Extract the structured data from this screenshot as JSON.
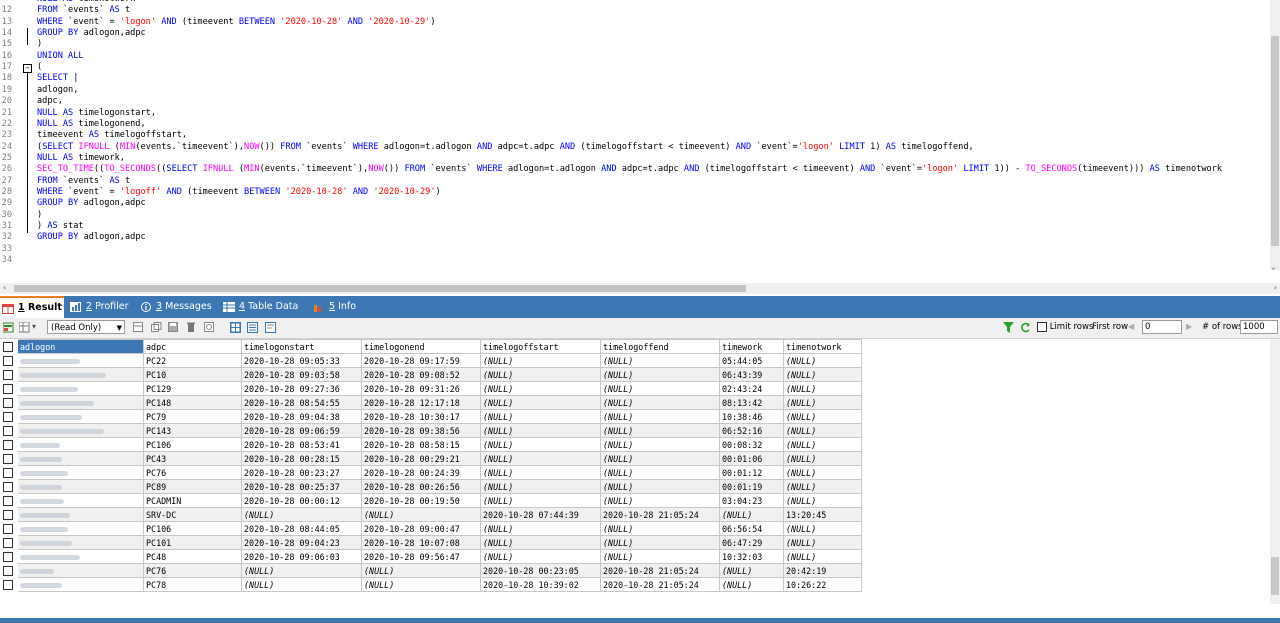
{
  "editor": {
    "lines": [
      {
        "n": "",
        "html": "<span class=\"kw\">NULL AS</span> timenotwork"
      },
      {
        "n": "12",
        "html": "<span class=\"kw\">FROM</span> `events` <span class=\"kw\">AS</span> t"
      },
      {
        "n": "13",
        "html": "<span class=\"kw\">WHERE</span> `event` = <span class=\"str\">'logon'</span> <span class=\"kw\">AND</span> (timeevent <span class=\"kw\">BETWEEN</span> <span class=\"str\">'2020-10-28'</span> <span class=\"kw\">AND</span> <span class=\"str\">'2020-10-29'</span>)"
      },
      {
        "n": "14",
        "html": "<span class=\"kw\">GROUP BY</span> adlogon,adpc"
      },
      {
        "n": "15",
        "html": ")"
      },
      {
        "n": "16",
        "html": "<span class=\"kw\">UNION ALL</span>"
      },
      {
        "n": "17",
        "html": "("
      },
      {
        "n": "18",
        "html": "<span class=\"kw\">SELECT</span> |"
      },
      {
        "n": "19",
        "html": "adlogon,"
      },
      {
        "n": "20",
        "html": "adpc,"
      },
      {
        "n": "21",
        "html": "<span class=\"kw\">NULL AS</span> timelogonstart,"
      },
      {
        "n": "22",
        "html": "<span class=\"kw\">NULL AS</span> timelogonend,"
      },
      {
        "n": "23",
        "html": "timeevent <span class=\"kw\">AS</span> timelogoffstart,"
      },
      {
        "n": "24",
        "html": "(<span class=\"kw\">SELECT</span> <span class=\"fn\">IFNULL</span> (<span class=\"fn\">MIN</span>(events.`timeevent`),<span class=\"fn\">NOW</span>()) <span class=\"kw\">FROM</span> `events` <span class=\"kw\">WHERE</span> adlogon=t.adlogon <span class=\"kw\">AND</span> adpc=t.adpc <span class=\"kw\">AND</span> (timelogoffstart &lt; timeevent) <span class=\"kw\">AND</span> `event`=<span class=\"str\">'logon'</span> <span class=\"kw\">LIMIT</span> 1) <span class=\"kw\">AS</span> timelogoffend,"
      },
      {
        "n": "25",
        "html": "<span class=\"kw\">NULL AS</span> timework,"
      },
      {
        "n": "26",
        "html": "<span class=\"fn\">SEC_TO_TIME</span>((<span class=\"fn\">TO_SECONDS</span>((<span class=\"kw\">SELECT</span> <span class=\"fn\">IFNULL</span> (<span class=\"fn\">MIN</span>(events.`timeevent`),<span class=\"fn\">NOW</span>()) <span class=\"kw\">FROM</span> `events` <span class=\"kw\">WHERE</span> adlogon=t.adlogon <span class=\"kw\">AND</span> adpc=t.adpc <span class=\"kw\">AND</span> (timelogoffstart &lt; timeevent) <span class=\"kw\">AND</span> `event`=<span class=\"str\">'logon'</span> <span class=\"kw\">LIMIT</span> 1)) - <span class=\"fn\">TO_SECONDS</span>(timeevent))) <span class=\"kw\">AS</span> timenotwork"
      },
      {
        "n": "27",
        "html": "<span class=\"kw\">FROM</span> `events` <span class=\"kw\">AS</span> t"
      },
      {
        "n": "28",
        "html": "<span class=\"kw\">WHERE</span> `event` = <span class=\"str\">'logoff'</span> <span class=\"kw\">AND</span> (timeevent <span class=\"kw\">BETWEEN</span> <span class=\"str\">'2020-10-28'</span> <span class=\"kw\">AND</span> <span class=\"str\">'2020-10-29'</span>)"
      },
      {
        "n": "29",
        "html": "<span class=\"kw\">GROUP BY</span> adlogon,adpc"
      },
      {
        "n": "30",
        "html": ")"
      },
      {
        "n": "31",
        "html": ") <span class=\"kw\">AS</span> stat"
      },
      {
        "n": "32",
        "html": "<span class=\"kw\">GROUP BY</span> adlogon,adpc"
      },
      {
        "n": "33",
        "html": ""
      },
      {
        "n": "34",
        "html": ""
      }
    ]
  },
  "tabs": [
    {
      "num": "1",
      "label": "Result",
      "active": true
    },
    {
      "num": "2",
      "label": "Profiler",
      "active": false
    },
    {
      "num": "3",
      "label": "Messages",
      "active": false
    },
    {
      "num": "4",
      "label": "Table Data",
      "active": false
    },
    {
      "num": "5",
      "label": "Info",
      "active": false
    }
  ],
  "toolbar": {
    "mode": "(Read Only)",
    "limit_label": "Limit rows",
    "first_row_label": "First row",
    "first_row": "0",
    "rows_label": "# of rows",
    "rows": "1000"
  },
  "grid": {
    "columns": [
      "adlogon",
      "adpc",
      "timelogonstart",
      "timelogonend",
      "timelogoffstart",
      "timelogoffend",
      "timework",
      "timenotwork"
    ],
    "rows": [
      [
        "",
        "PC22",
        "2020-10-28 09:05:33",
        "2020-10-28 09:17:59",
        "(NULL)",
        "(NULL)",
        "05:44:05",
        "(NULL)"
      ],
      [
        "",
        "PC10",
        "2020-10-28 09:03:58",
        "2020-10-28 09:08:52",
        "(NULL)",
        "(NULL)",
        "06:43:39",
        "(NULL)"
      ],
      [
        "",
        "PC129",
        "2020-10-28 09:27:36",
        "2020-10-28 09:31:26",
        "(NULL)",
        "(NULL)",
        "02:43:24",
        "(NULL)"
      ],
      [
        "",
        "PC148",
        "2020-10-28 08:54:55",
        "2020-10-28 12:17:18",
        "(NULL)",
        "(NULL)",
        "08:13:42",
        "(NULL)"
      ],
      [
        "",
        "PC79",
        "2020-10-28 09:04:38",
        "2020-10-28 10:30:17",
        "(NULL)",
        "(NULL)",
        "10:38:46",
        "(NULL)"
      ],
      [
        "",
        "PC143",
        "2020-10-28 09:06:59",
        "2020-10-28 09:38:56",
        "(NULL)",
        "(NULL)",
        "06:52:16",
        "(NULL)"
      ],
      [
        "",
        "PC106",
        "2020-10-28 08:53:41",
        "2020-10-28 08:58:15",
        "(NULL)",
        "(NULL)",
        "00:08:32",
        "(NULL)"
      ],
      [
        "",
        "PC43",
        "2020-10-28 00:28:15",
        "2020-10-28 00:29:21",
        "(NULL)",
        "(NULL)",
        "00:01:06",
        "(NULL)"
      ],
      [
        "",
        "PC76",
        "2020-10-28 00:23:27",
        "2020-10-28 00:24:39",
        "(NULL)",
        "(NULL)",
        "00:01:12",
        "(NULL)"
      ],
      [
        "",
        "PC89",
        "2020-10-28 00:25:37",
        "2020-10-28 00:26:56",
        "(NULL)",
        "(NULL)",
        "00:01:19",
        "(NULL)"
      ],
      [
        "",
        "PCADMIN",
        "2020-10-28 00:00:12",
        "2020-10-28 00:19:50",
        "(NULL)",
        "(NULL)",
        "03:04:23",
        "(NULL)"
      ],
      [
        "",
        "SRV-DC",
        "(NULL)",
        "(NULL)",
        "2020-10-28 07:44:39",
        "2020-10-28 21:05:24",
        "(NULL)",
        "13:20:45"
      ],
      [
        "",
        "PC106",
        "2020-10-28 08:44:05",
        "2020-10-28 09:00:47",
        "(NULL)",
        "(NULL)",
        "06:56:54",
        "(NULL)"
      ],
      [
        "",
        "PC101",
        "2020-10-28 09:04:23",
        "2020-10-28 10:07:08",
        "(NULL)",
        "(NULL)",
        "06:47:29",
        "(NULL)"
      ],
      [
        "",
        "PC48",
        "2020-10-28 09:06:03",
        "2020-10-28 09:56:47",
        "(NULL)",
        "(NULL)",
        "10:32:03",
        "(NULL)"
      ],
      [
        "",
        "PC76",
        "(NULL)",
        "(NULL)",
        "2020-10-28 00:23:05",
        "2020-10-28 21:05:24",
        "(NULL)",
        "20:42:19"
      ],
      [
        "",
        "PC78",
        "(NULL)",
        "(NULL)",
        "2020-10-28 10:39:02",
        "2020-10-28 21:05:24",
        "(NULL)",
        "10:26:22"
      ]
    ]
  },
  "colors": {
    "accent": "#3d78b5",
    "tab_active_border": "#f07c1e",
    "keyword": "#0000ff",
    "string": "#ff0000",
    "function": "#ff00ff"
  }
}
